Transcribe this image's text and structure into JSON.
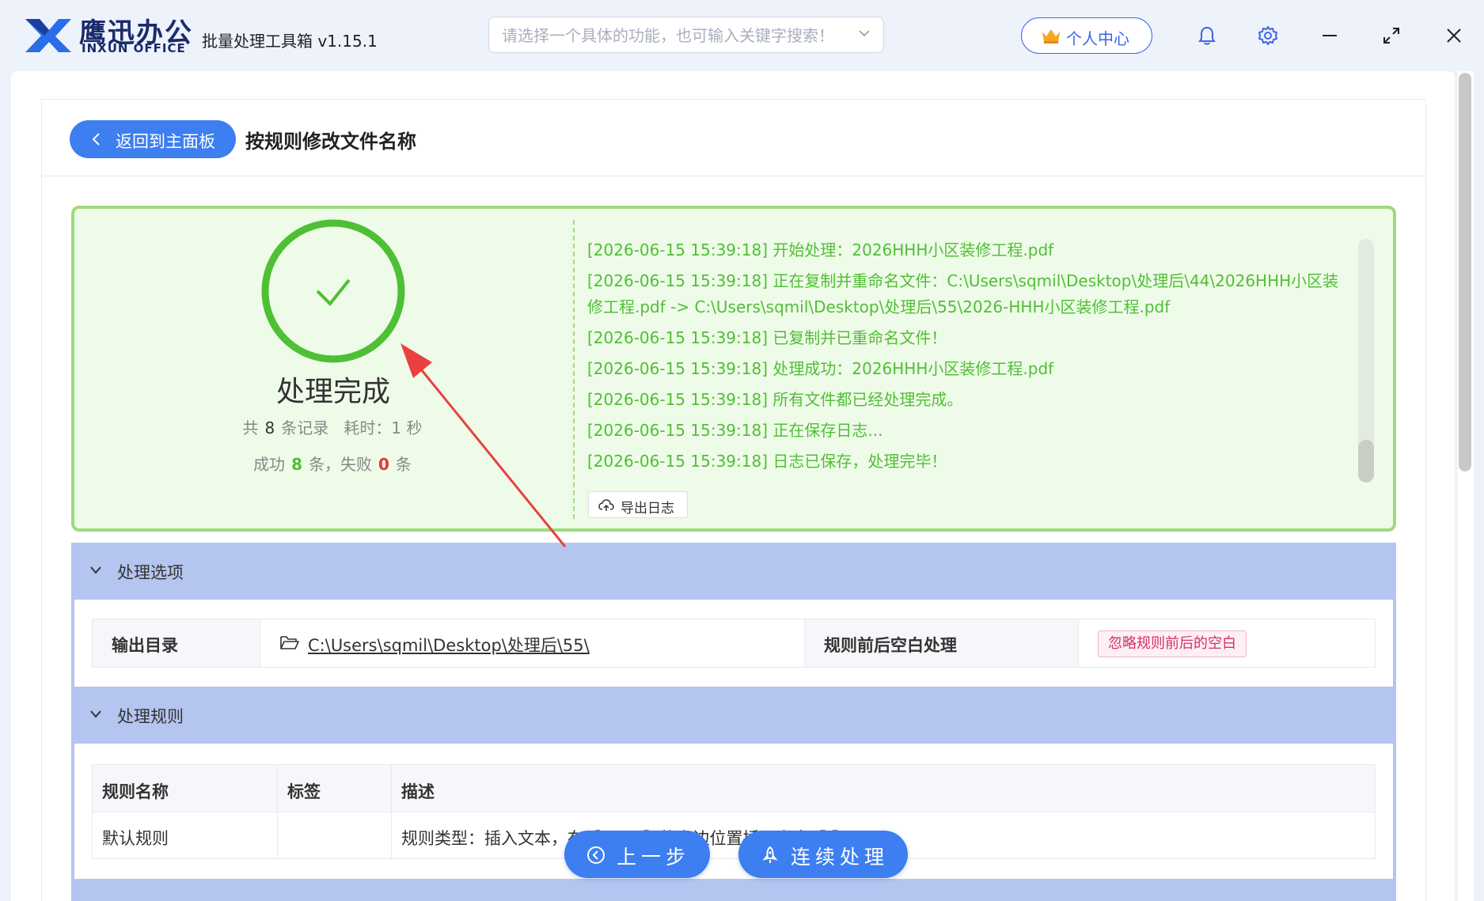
{
  "titlebar": {
    "brand_cn": "鹰迅办公",
    "brand_en": "INXUN OFFICE",
    "app_title": "批量处理工具箱 v1.15.1",
    "search_placeholder": "请选择一个具体的功能，也可输入关键字搜索！",
    "user_center": "个人中心",
    "icons": [
      "logo-icon",
      "chevron-down-icon",
      "crown-icon",
      "bell-icon",
      "gear-icon",
      "minimize-icon",
      "maximize-icon",
      "close-icon"
    ]
  },
  "header": {
    "back_button": "返回到主面板",
    "page_title": "按规则修改文件名称"
  },
  "result": {
    "status_title": "处理完成",
    "total_prefix": "共",
    "total_count": "8",
    "total_suffix": "条记录",
    "time_label": "耗时：1 秒",
    "success_prefix": "成功",
    "success_count": "8",
    "success_suffix": "条，失败",
    "fail_count": "0",
    "fail_suffix": "条",
    "status_color": "#4fbf35",
    "fail_color": "#f0303c",
    "export_button": "导出日志",
    "log_lines": [
      "[2026-06-15 15:39:18] 开始处理：2026HHH小区装修工程.pdf",
      "[2026-06-15 15:39:18] 正在复制并重命名文件：C:\\Users\\sqmil\\Desktop\\处理后\\44\\2026HHH小区装修工程.pdf -> C:\\Users\\sqmil\\Desktop\\处理后\\55\\2026-HHH小区装修工程.pdf",
      "[2026-06-15 15:39:18] 已复制并已重命名文件！",
      "[2026-06-15 15:39:18] 处理成功：2026HHH小区装修工程.pdf",
      "[2026-06-15 15:39:18] 所有文件都已经处理完成。",
      "[2026-06-15 15:39:18] 正在保存日志...",
      "[2026-06-15 15:39:18] 日志已保存，处理完毕！"
    ]
  },
  "options_section": {
    "title": "处理选项",
    "output_dir_label": "输出目录",
    "output_dir_value": "C:\\Users\\sqmil\\Desktop\\处理后\\55\\",
    "whitespace_label": "规则前后空白处理",
    "whitespace_value": "忽略规则前后的空白"
  },
  "rules_section": {
    "title": "处理规则",
    "columns": [
      "规则名称",
      "标签",
      "描述"
    ],
    "rows": [
      {
        "name": "默认规则",
        "tag": "",
        "desc": "规则类型：插入文本，在【2026】的右边位置插入文本【-】"
      }
    ]
  },
  "actions": {
    "prev_step": "上一步",
    "continue": "连续处理"
  }
}
